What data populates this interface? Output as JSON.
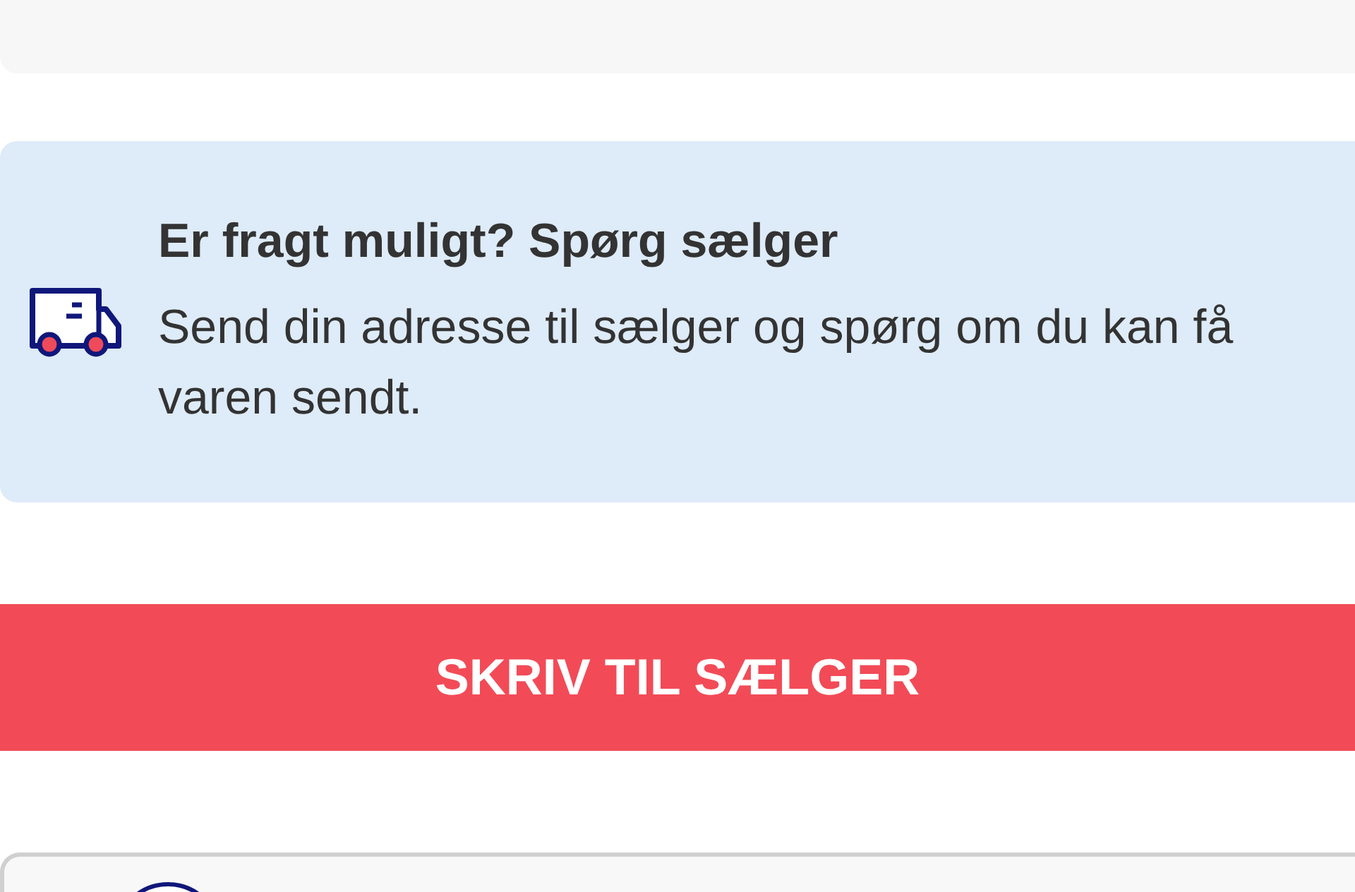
{
  "shipping_notice": {
    "title": "Er fragt muligt? Spørg sælger",
    "text": "Send din adresse til sælger og spørg om du kan få varen sendt."
  },
  "contact_button": {
    "label": "SKRIV TIL SÆLGER"
  }
}
